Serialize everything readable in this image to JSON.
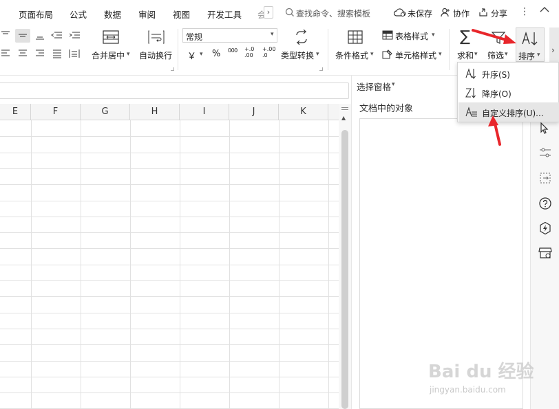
{
  "menu": {
    "tabs": [
      "页面布局",
      "公式",
      "数据",
      "审阅",
      "视图",
      "开发工具",
      "会"
    ],
    "search_placeholder": "查找命令、搜索模板",
    "unsaved": "未保存",
    "collaborate": "协作",
    "share": "分享"
  },
  "ribbon": {
    "merge_center": "合并居中",
    "wrap_text": "自动换行",
    "number_format": "常规",
    "currency_symbol": "￥",
    "percent_symbol": "%",
    "thousands_symbol": "000",
    "dec_increase": "+.0\n.00",
    "dec_decrease": "+.00\n.0",
    "type_convert": "类型转换",
    "conditional_format": "条件格式",
    "table_style": "表格样式",
    "cell_style": "单元格样式",
    "sum": "求和",
    "filter": "筛选",
    "sort": "排序"
  },
  "sort_menu": {
    "ascending": "升序(S)",
    "descending": "降序(O)",
    "custom": "自定义排序(U)..."
  },
  "grid": {
    "columns": [
      "E",
      "F",
      "G",
      "H",
      "I",
      "J",
      "K"
    ]
  },
  "pane": {
    "title": "选择窗格",
    "subtitle": "文档中的对象"
  },
  "watermark": {
    "logo": "Bai du 经验",
    "url": "jingyan.baidu.com"
  },
  "colors": {
    "accent_red": "#e8262b",
    "active_blue": "#4a90e2",
    "grid_line": "#e1e1e1"
  }
}
